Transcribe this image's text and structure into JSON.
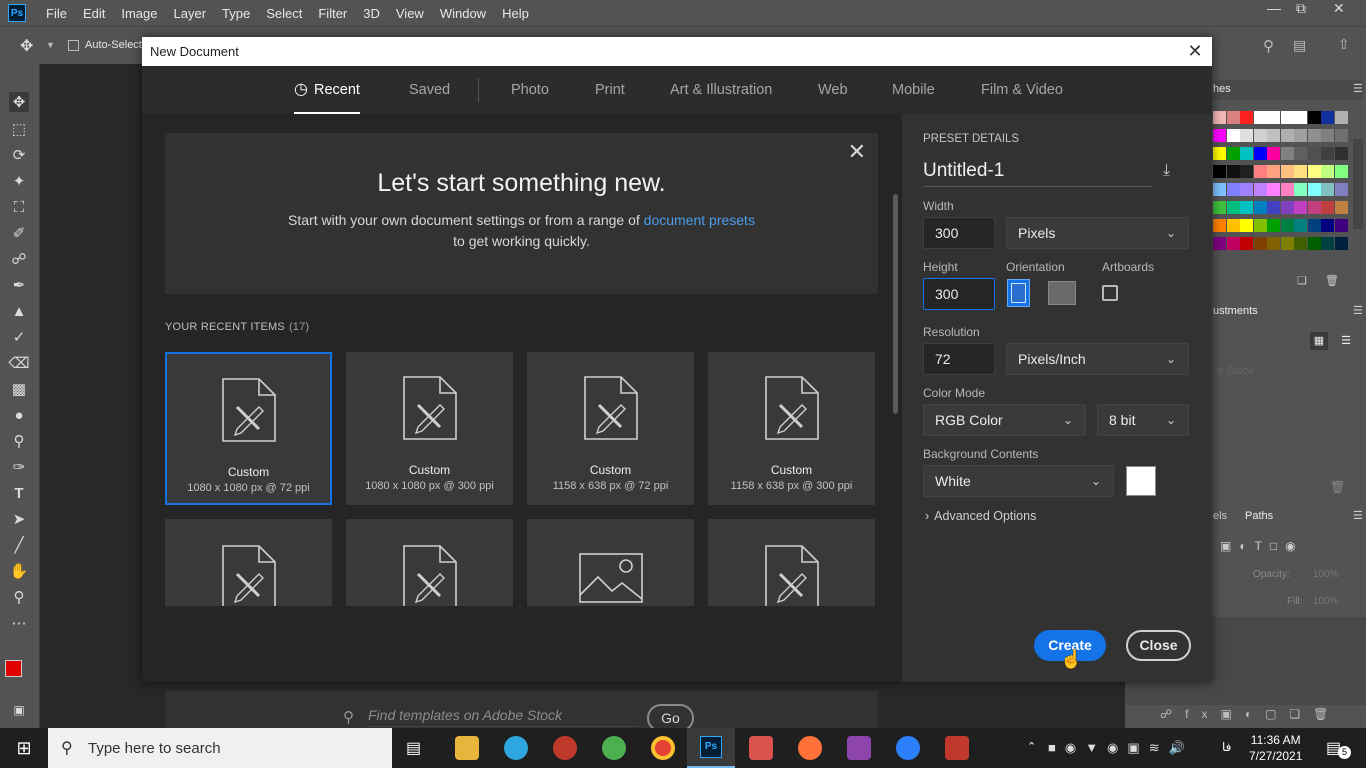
{
  "app": {
    "menu": [
      "File",
      "Edit",
      "Image",
      "Layer",
      "Type",
      "Select",
      "Filter",
      "3D",
      "View",
      "Window",
      "Help"
    ],
    "options": {
      "auto_select_label": "Auto-Select:"
    },
    "panels": {
      "swatches_tab": "hes",
      "adjustments_tab": "ustments",
      "channels_tab": "els",
      "paths_tab": "Paths",
      "stock_placeholder": "e Stock",
      "opacity_label": "Opacity:",
      "opacity_value": "100%",
      "fill_label": "Fill:",
      "fill_value": "100%"
    }
  },
  "dialog": {
    "title": "New Document",
    "tabs": [
      "Recent",
      "Saved",
      "Photo",
      "Print",
      "Art & Illustration",
      "Web",
      "Mobile",
      "Film & Video"
    ],
    "active_tab": "Recent",
    "hero": {
      "heading": "Let's start something new.",
      "text_before": "Start with your own document settings or from a range of ",
      "link": "document presets",
      "text_after": "to get working quickly."
    },
    "recent_header": "YOUR RECENT ITEMS",
    "recent_count": "(17)",
    "recent_items": [
      {
        "name": "Custom",
        "detail": "1080 x 1080 px @ 72 ppi"
      },
      {
        "name": "Custom",
        "detail": "1080 x 1080 px @ 300 ppi"
      },
      {
        "name": "Custom",
        "detail": "1158 x 638 px @ 72 ppi"
      },
      {
        "name": "Custom",
        "detail": "1158 x 638 px @ 300 ppi"
      }
    ],
    "search_placeholder": "Find templates on Adobe Stock",
    "go_label": "Go",
    "preset": {
      "header": "PRESET DETAILS",
      "name": "Untitled-1",
      "width_label": "Width",
      "width_value": "300",
      "width_unit": "Pixels",
      "height_label": "Height",
      "height_value": "300",
      "orientation_label": "Orientation",
      "artboards_label": "Artboards",
      "resolution_label": "Resolution",
      "resolution_value": "72",
      "resolution_unit": "Pixels/Inch",
      "color_mode_label": "Color Mode",
      "color_mode": "RGB Color",
      "bit_depth": "8 bit",
      "bg_label": "Background Contents",
      "bg_value": "White",
      "advanced": "Advanced Options"
    },
    "create_label": "Create",
    "close_label": "Close"
  },
  "taskbar": {
    "search_placeholder": "Type here to search",
    "time": "11:36 AM",
    "date": "7/27/2021",
    "lang": "فا",
    "notif_count": "5"
  },
  "colors": {
    "accent": "#1473e6",
    "fg_color": "#e00000",
    "bg_color": "#ffffff"
  }
}
